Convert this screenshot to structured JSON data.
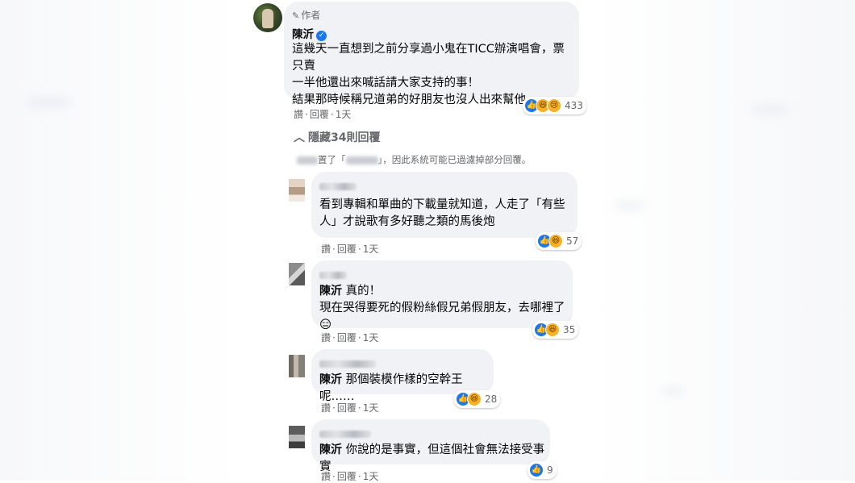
{
  "author_comment": {
    "tag": "作者",
    "name": "陳沂",
    "lines": [
      "這幾天一直想到之前分享過小鬼在TICC辦演唱會，票只賣",
      "一半他還出來喊話請大家支持的事！",
      "結果那時候稱兄道弟的好朋友也沒人出來幫他……"
    ],
    "actions": {
      "like": "讚",
      "sep": "·",
      "reply": "回覆",
      "time": "1天"
    },
    "reaction_count": "433"
  },
  "hide_replies": "隱藏34則回覆",
  "filter_notice": {
    "prefix": "置了「",
    "middle": "」，因此系統可能已過濾掉部分回覆。"
  },
  "replies": [
    {
      "lines": [
        "看到專輯和單曲的下載量就知道，人走了「有些",
        "人」才說歌有多好聽之類的馬後炮"
      ],
      "time": "1天",
      "reaction_count": "57"
    },
    {
      "mention": "陳沂",
      "lines": [
        "真的！",
        "現在哭得要死的假粉絲假兄弟假朋友，去哪裡了😑"
      ],
      "time": "1天",
      "reaction_count": "35"
    },
    {
      "mention": "陳沂",
      "lines": [
        "那個裝模作樣的空幹王呢……"
      ],
      "time": "1天",
      "reaction_count": "28"
    },
    {
      "mention": "陳沂",
      "lines": [
        "你說的是事實，但這個社會無法接受事實"
      ],
      "time": "1天",
      "reaction_count": "9"
    }
  ],
  "common": {
    "like": "讚",
    "sep": "·",
    "reply": "回覆"
  },
  "colors": {
    "bubble": "#f0f2f5",
    "like_blue": "#1877f2",
    "meta_gray": "#65676b"
  }
}
